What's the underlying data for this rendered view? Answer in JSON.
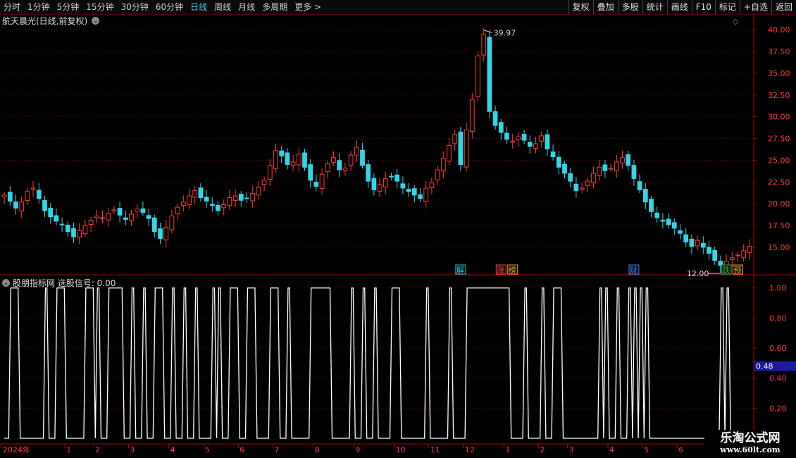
{
  "toolbar": {
    "periods": [
      "分时",
      "1分钟",
      "5分钟",
      "15分钟",
      "30分钟",
      "60分钟",
      "日线",
      "周线",
      "月线",
      "多周期",
      "更多 >"
    ],
    "active_index": 6,
    "buttons": [
      "复权",
      "叠加",
      "多股",
      "统计",
      "画线",
      "F10",
      "标记",
      "+自选",
      "返回"
    ]
  },
  "main_title": "航天晨光(日线,前复权)",
  "indicator_title": "股朋指标网 选股信号: 0.00",
  "watermark": {
    "line1": "乐淘公式网",
    "line2": "www.60lt.com"
  },
  "colors": {
    "up": "#ff3b3b",
    "down": "#33d6e6",
    "grid": "#7a0000",
    "axis": "#b00000",
    "text": "#c8c8c8",
    "signal": "#ffffff"
  },
  "chart_data": [
    {
      "type": "candlestick",
      "ylim": [
        12.0,
        40.5
      ],
      "yticks": [
        "40.00",
        "37.50",
        "35.00",
        "32.50",
        "30.00",
        "27.50",
        "25.00",
        "22.50",
        "20.00",
        "17.50",
        "15.00"
      ],
      "max_label": "39.97",
      "min_label": "12.00",
      "close_path": [
        21.0,
        20.3,
        19.5,
        20.2,
        21.4,
        21.8,
        20.6,
        19.2,
        18.5,
        18.0,
        17.6,
        16.8,
        16.2,
        16.9,
        17.5,
        18.1,
        18.6,
        18.4,
        18.9,
        19.3,
        18.7,
        18.2,
        18.8,
        19.4,
        19.0,
        18.3,
        16.8,
        16.0,
        17.3,
        18.6,
        19.6,
        20.2,
        20.9,
        21.5,
        20.7,
        20.3,
        19.8,
        19.2,
        19.9,
        20.7,
        20.9,
        20.4,
        20.6,
        21.2,
        21.9,
        22.7,
        24.4,
        26.1,
        25.5,
        24.5,
        24.8,
        25.7,
        24.2,
        22.7,
        22.0,
        23.4,
        24.6,
        25.3,
        23.9,
        24.1,
        25.6,
        26.5,
        24.4,
        22.6,
        21.6,
        22.2,
        22.9,
        23.1,
        22.6,
        21.8,
        21.4,
        21.0,
        20.6,
        21.8,
        22.4,
        23.9,
        25.2,
        26.7,
        28.0,
        24.5,
        28.5,
        32.0,
        37.0,
        39.5,
        30.6,
        29.0,
        28.2,
        27.4,
        27.2,
        27.7,
        27.3,
        26.6,
        26.9,
        27.8,
        26.3,
        25.4,
        24.2,
        23.5,
        22.6,
        21.5,
        21.8,
        22.6,
        23.5,
        24.2,
        23.8,
        24.1,
        24.8,
        25.3,
        24.4,
        22.9,
        21.6,
        20.2,
        19.1,
        18.4,
        18.0,
        17.6,
        17.2,
        16.6,
        15.6,
        15.1,
        15.8,
        15.0,
        14.3,
        13.5,
        12.9,
        13.4,
        13.8,
        14.1,
        14.6,
        15.1
      ],
      "xticks": [
        {
          "label": "2024年",
          "i": 0
        },
        {
          "label": "1",
          "i": 11
        },
        {
          "label": "2",
          "i": 16
        },
        {
          "label": "3",
          "i": 22
        },
        {
          "label": "4",
          "i": 29
        },
        {
          "label": "5",
          "i": 35
        },
        {
          "label": "6",
          "i": 41
        },
        {
          "label": "7",
          "i": 47
        },
        {
          "label": "8",
          "i": 54
        },
        {
          "label": "9",
          "i": 61
        },
        {
          "label": "10",
          "i": 68
        },
        {
          "label": "11",
          "i": 74
        },
        {
          "label": "12",
          "i": 80
        },
        {
          "label": "1",
          "i": 87
        },
        {
          "label": "2",
          "i": 93
        },
        {
          "label": "3",
          "i": 98
        },
        {
          "label": "4",
          "i": 105
        },
        {
          "label": "5",
          "i": 111
        },
        {
          "label": "6",
          "i": 117
        }
      ],
      "markers": [
        {
          "label": "解",
          "i": 79,
          "color": "#19c2d8"
        },
        {
          "label": "涨",
          "i": 86,
          "color": "#ff3b3b"
        },
        {
          "label": "榜",
          "i": 88,
          "color": "#e0a020"
        },
        {
          "label": "财",
          "i": 109,
          "color": "#3b7bff"
        },
        {
          "label": "跌",
          "i": 125,
          "color": "#2ab04a"
        },
        {
          "label": "预",
          "i": 127,
          "color": "#e0a020"
        }
      ]
    },
    {
      "type": "line",
      "series_label": "选股信号",
      "current_value": "0.00",
      "ylim": [
        0,
        1.05
      ],
      "yticks": [
        "1.00",
        "0.80",
        "0.60",
        "0.40",
        "0.20"
      ],
      "highlight_value": "0.48",
      "signal_segments": [
        [
          1,
          3
        ],
        [
          7,
          8
        ],
        [
          9,
          11
        ],
        [
          14,
          16
        ],
        [
          16,
          17
        ],
        [
          18,
          21
        ],
        [
          22,
          23
        ],
        [
          24,
          25
        ],
        [
          26,
          28
        ],
        [
          29,
          30
        ],
        [
          31,
          32
        ],
        [
          33,
          34
        ],
        [
          36,
          37
        ],
        [
          37,
          38
        ],
        [
          39,
          41
        ],
        [
          42,
          44
        ],
        [
          46,
          48
        ],
        [
          49,
          50
        ],
        [
          53,
          57
        ],
        [
          60,
          61
        ],
        [
          62,
          63
        ],
        [
          64,
          65
        ],
        [
          67,
          69
        ],
        [
          73,
          74
        ],
        [
          77,
          78
        ],
        [
          80,
          88
        ],
        [
          90,
          91
        ],
        [
          93,
          94
        ],
        [
          95,
          97
        ],
        [
          103,
          104
        ],
        [
          104,
          105
        ],
        [
          106,
          107
        ],
        [
          108,
          109
        ],
        [
          109,
          110
        ],
        [
          110,
          111
        ],
        [
          111,
          112
        ],
        [
          124,
          125
        ],
        [
          125,
          126
        ]
      ]
    }
  ]
}
